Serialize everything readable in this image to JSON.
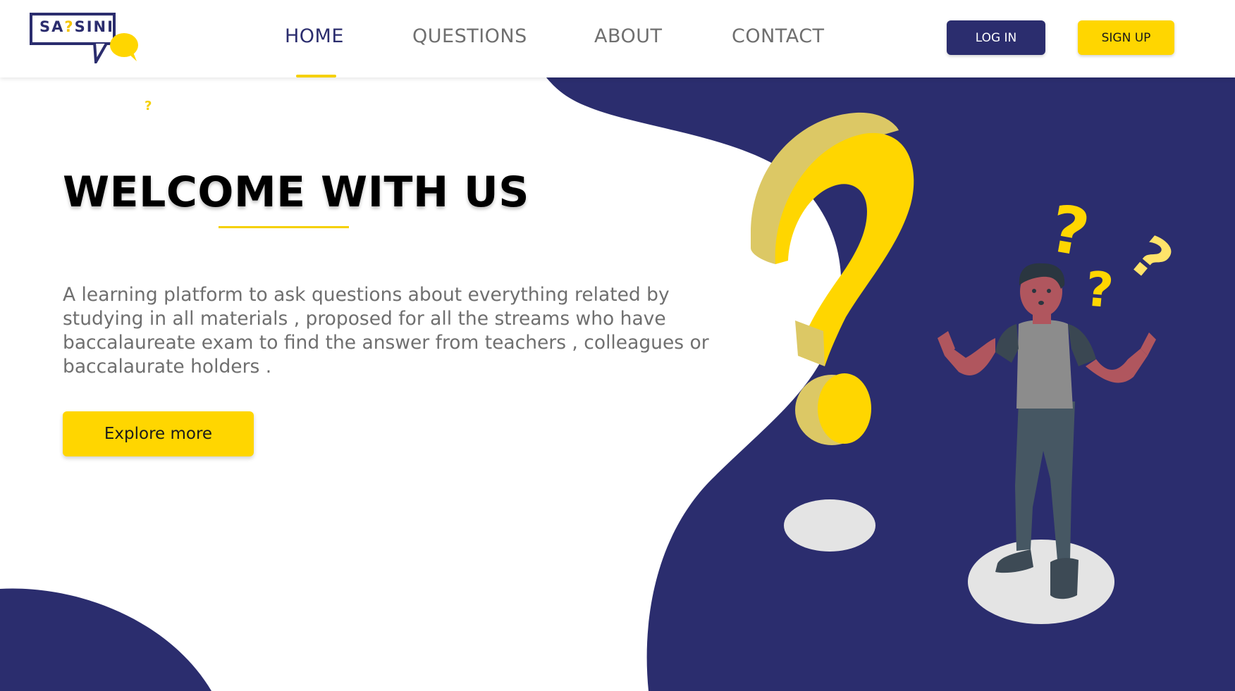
{
  "brand": {
    "logo_text_before": "SA",
    "logo_text_q": "?",
    "logo_text_after": "SINI"
  },
  "nav": {
    "items": [
      {
        "label": "HOME",
        "active": true
      },
      {
        "label": "QUESTIONS",
        "active": false
      },
      {
        "label": "ABOUT",
        "active": false
      },
      {
        "label": "CONTACT",
        "active": false
      }
    ]
  },
  "auth": {
    "login_label": "LOG IN",
    "signup_label": "SIGN UP"
  },
  "hero": {
    "title": "WELCOME WITH US",
    "description": "A learning platform to ask questions about everything related by studying in all materials , proposed for all the streams who have baccalaureate exam to find the answer from teachers , colleagues or baccalaurate holders .",
    "explore_label": "Explore more",
    "small_mark": "?"
  },
  "illustration": {
    "marks": [
      "?",
      "?",
      "?"
    ]
  },
  "colors": {
    "navy": "#2b2d6e",
    "yellow": "#ffd600",
    "text_gray": "#6f6f6f"
  }
}
